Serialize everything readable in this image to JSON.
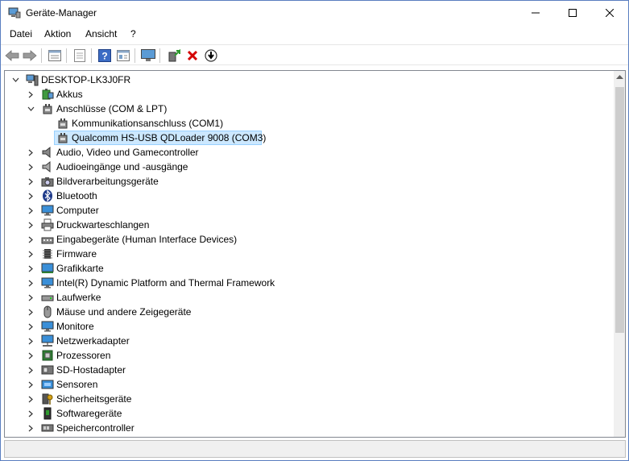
{
  "window": {
    "title": "Geräte-Manager",
    "minimize_glyph": "—",
    "maximize_glyph": "☐",
    "close_glyph": "✕"
  },
  "menu": {
    "items": [
      {
        "label": "Datei"
      },
      {
        "label": "Aktion"
      },
      {
        "label": "Ansicht"
      },
      {
        "label": "?"
      }
    ]
  },
  "toolbar": {
    "icons": [
      "back-icon",
      "forward-icon",
      "properties-view-icon",
      "print-icon",
      "help-icon",
      "details-icon",
      "monitor-scan-icon",
      "update-driver-icon",
      "uninstall-icon",
      "download-icon"
    ]
  },
  "tree": {
    "root": {
      "label": "DESKTOP-LK3J0FR",
      "icon": "computer-icon",
      "expanded": true
    },
    "nodes": [
      {
        "label": "Akkus",
        "icon": "battery-icon",
        "expanded": false
      },
      {
        "label": "Anschlüsse (COM & LPT)",
        "icon": "port-icon",
        "expanded": true,
        "children": [
          {
            "label": "Kommunikationsanschluss (COM1)",
            "icon": "port-icon",
            "selected": false
          },
          {
            "label": "Qualcomm HS-USB QDLoader 9008 (COM3)",
            "icon": "port-icon",
            "selected": true
          }
        ]
      },
      {
        "label": "Audio, Video und Gamecontroller",
        "icon": "speaker-icon",
        "expanded": false
      },
      {
        "label": "Audioeingänge und -ausgänge",
        "icon": "speaker-icon",
        "expanded": false
      },
      {
        "label": "Bildverarbeitungsgeräte",
        "icon": "camera-icon",
        "expanded": false
      },
      {
        "label": "Bluetooth",
        "icon": "bluetooth-icon",
        "expanded": false
      },
      {
        "label": "Computer",
        "icon": "monitor-icon",
        "expanded": false
      },
      {
        "label": "Druckwarteschlangen",
        "icon": "printer-icon",
        "expanded": false
      },
      {
        "label": "Eingabegeräte (Human Interface Devices)",
        "icon": "hid-icon",
        "expanded": false
      },
      {
        "label": "Firmware",
        "icon": "chip-icon",
        "expanded": false
      },
      {
        "label": "Grafikkarte",
        "icon": "display-adapter-icon",
        "expanded": false
      },
      {
        "label": "Intel(R) Dynamic Platform and Thermal Framework",
        "icon": "chip-icon",
        "expanded": false
      },
      {
        "label": "Laufwerke",
        "icon": "drive-icon",
        "expanded": false
      },
      {
        "label": "Mäuse und andere Zeigegeräte",
        "icon": "mouse-icon",
        "expanded": false
      },
      {
        "label": "Monitore",
        "icon": "monitor-icon",
        "expanded": false
      },
      {
        "label": "Netzwerkadapter",
        "icon": "network-icon",
        "expanded": false
      },
      {
        "label": "Prozessoren",
        "icon": "processor-icon",
        "expanded": false
      },
      {
        "label": "SD-Hostadapter",
        "icon": "sd-card-icon",
        "expanded": false
      },
      {
        "label": "Sensoren",
        "icon": "sensor-icon",
        "expanded": false
      },
      {
        "label": "Sicherheitsgeräte",
        "icon": "security-key-icon",
        "expanded": false
      },
      {
        "label": "Softwaregeräte",
        "icon": "software-device-icon",
        "expanded": false
      },
      {
        "label": "Speichercontroller",
        "icon": "storage-controller-icon",
        "expanded": false
      }
    ]
  },
  "colors": {
    "selection_bg": "#cce8ff",
    "selection_border": "#99d1ff",
    "accent": "#0078d7"
  }
}
